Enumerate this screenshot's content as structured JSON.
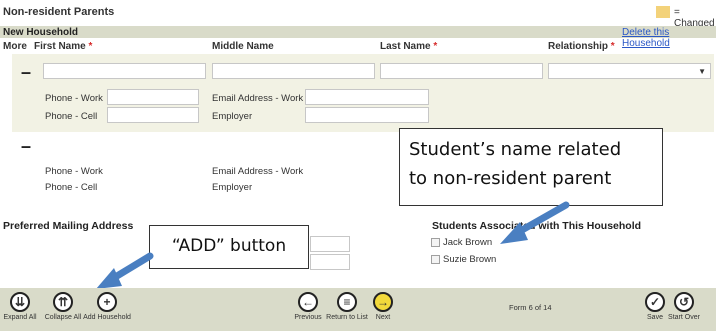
{
  "header": {
    "title": "Non-resident Parents",
    "legend_label": "= Changed",
    "changed_color": "#f3d27a"
  },
  "household": {
    "title": "New Household",
    "delete_link": "Delete this Household"
  },
  "columns": {
    "more": "More",
    "first_name": "First Name",
    "middle_name": "Middle Name",
    "last_name": "Last Name",
    "relationship": "Relationship",
    "required_mark": "*"
  },
  "record1": {
    "collapse_symbol": "–",
    "phone_work_label": "Phone - Work",
    "phone_cell_label": "Phone - Cell",
    "email_work_label": "Email Address - Work",
    "employer_label": "Employer",
    "first_name_value": "",
    "middle_name_value": "",
    "last_name_value": "",
    "relationship_value": "",
    "phone_work_value": "",
    "phone_cell_value": "",
    "email_work_value": "",
    "employer_value": ""
  },
  "record2": {
    "collapse_symbol": "–",
    "phone_work_label": "Phone - Work",
    "phone_cell_label": "Phone - Cell",
    "email_work_label": "Email Address - Work",
    "employer_label": "Employer"
  },
  "mailing": {
    "title": "Preferred Mailing Address"
  },
  "students": {
    "title": "Students Associated with This Household",
    "list": [
      "Jack Brown",
      "Suzie Brown"
    ]
  },
  "callouts": {
    "student_name": "Student’s name related\nto non-resident parent",
    "add_button": "“ADD” button",
    "arrow_color": "#4a7fc1"
  },
  "toolbar": {
    "expand_all": "Expand All",
    "collapse_all": "Collapse All",
    "add_household": "Add Household",
    "previous": "Previous",
    "return_to_list": "Return to List",
    "next": "Next",
    "form_position": "Form 6 of 14",
    "save": "Save",
    "start_over": "Start Over"
  }
}
